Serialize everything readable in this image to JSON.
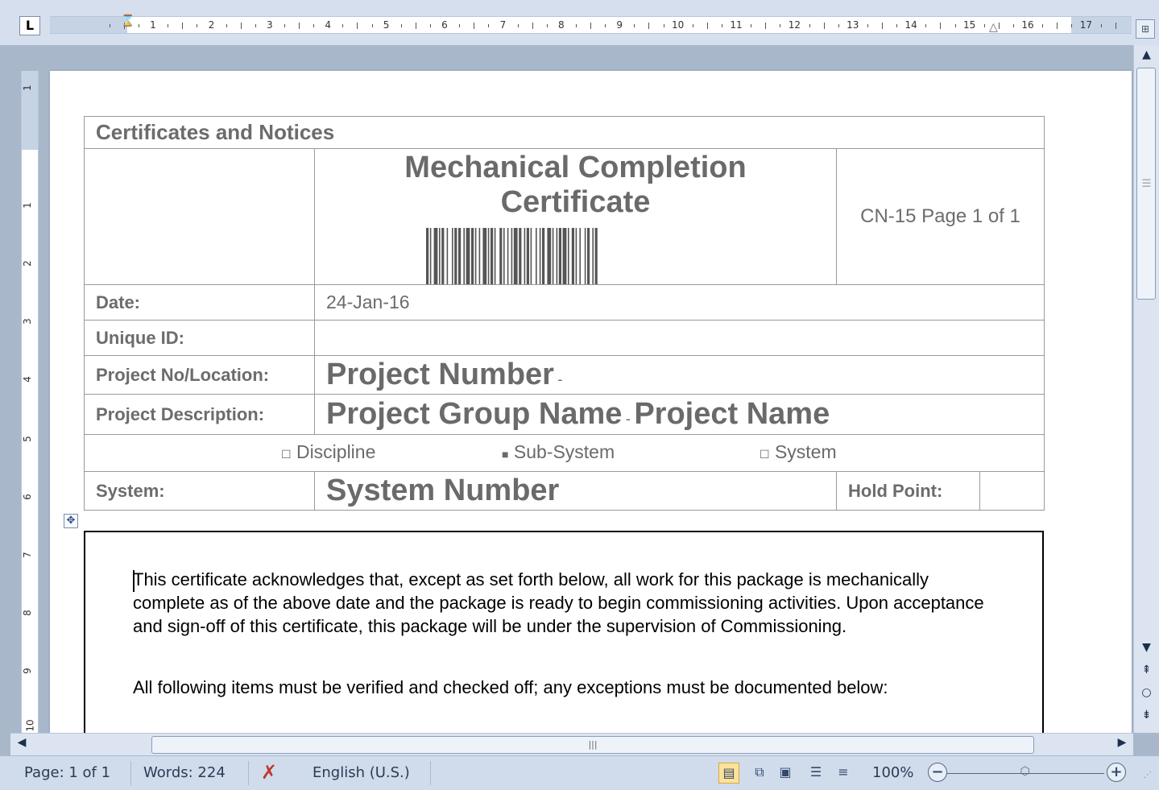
{
  "ruler": {
    "tab_selector": "L",
    "numbers": [
      "1",
      "2",
      "3",
      "4",
      "5",
      "6",
      "7",
      "8",
      "9",
      "10",
      "11",
      "12",
      "13",
      "14",
      "15",
      "16",
      "17"
    ],
    "vertical_numbers": [
      "1",
      "1",
      "2",
      "3",
      "4",
      "5",
      "6",
      "7",
      "8",
      "9",
      "10"
    ]
  },
  "document": {
    "section_title": "Certificates and Notices",
    "cert_title_line1": "Mechanical Completion",
    "cert_title_line2": "Certificate",
    "doc_ref": "CN-15  Page 1 of 1",
    "rows": {
      "date_label": "Date:",
      "date_value": "24-Jan-16",
      "unique_id_label": "Unique ID:",
      "unique_id_value": "",
      "project_no_label": "Project No/Location:",
      "project_no_value": "Project Number",
      "project_no_suffix": "-",
      "project_desc_label": "Project Description:",
      "project_group": "Project Group Name",
      "project_desc_sep": "-",
      "project_name": "Project Name",
      "system_label": "System:",
      "system_value": "System Number",
      "hold_point_label": "Hold Point:",
      "hold_point_value": ""
    },
    "options": [
      {
        "label": "Discipline",
        "checked": false
      },
      {
        "label": "Sub-System",
        "checked": true
      },
      {
        "label": "System",
        "checked": false
      }
    ],
    "paragraph1": "This certificate acknowledges that, except as set forth below, all work for this package is mechanically complete as of the above date and the package is ready to begin commissioning activities.  Upon acceptance and sign-off of this certificate, this package will be under the supervision of Commissioning.",
    "paragraph2": "All following items must be verified and checked off; any exceptions must be documented below:"
  },
  "statusbar": {
    "page": "Page: 1 of 1",
    "words": "Words: 224",
    "language": "English (U.S.)",
    "zoom": "100%",
    "zoom_level": 0.5
  },
  "colors": {
    "chrome": "#d5dfee",
    "page": "#ffffff",
    "table_text": "#6a6a6a"
  }
}
